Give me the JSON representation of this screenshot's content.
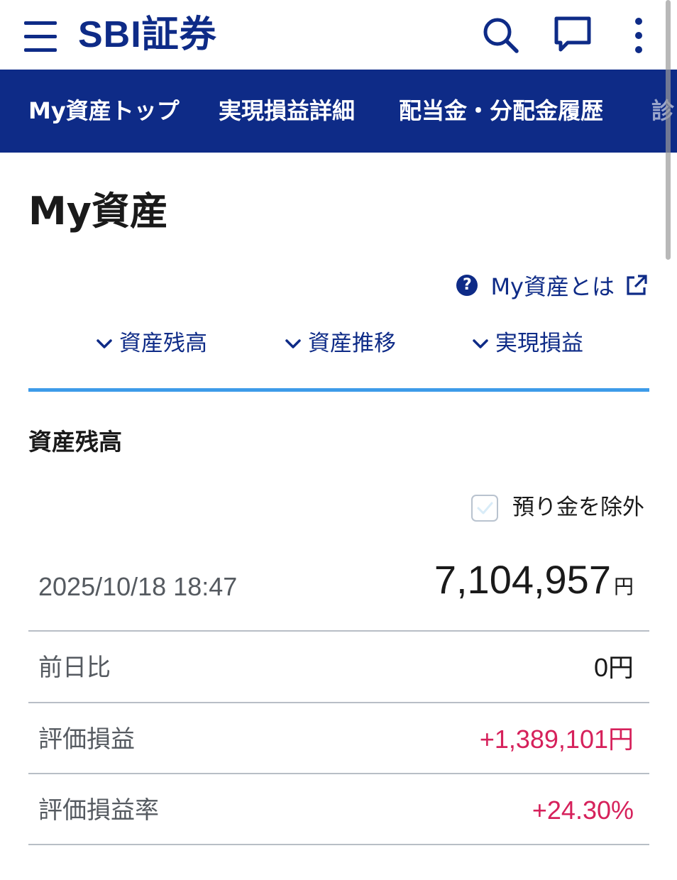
{
  "header": {
    "logo_text": "SBI証券",
    "icons": [
      "menu-icon",
      "search-icon",
      "chat-icon",
      "kebab-menu-icon"
    ]
  },
  "nav": {
    "items": [
      {
        "label": "My資産トップ"
      },
      {
        "label": "実現損益詳細"
      },
      {
        "label": "配当金・分配金履歴"
      },
      {
        "label": "診"
      }
    ]
  },
  "page": {
    "title": "My資産",
    "help_link": "My資産とは",
    "help_icon_glyph": "?"
  },
  "anchors": [
    {
      "label": "資産残高"
    },
    {
      "label": "資産推移"
    },
    {
      "label": "実現損益"
    }
  ],
  "balance": {
    "heading": "資産残高",
    "exclude_deposit_label": "預り金を除外",
    "timestamp": "2025/10/18 18:47",
    "total_amount": "7,104,957",
    "total_unit": "円",
    "rows": [
      {
        "label": "前日比",
        "value": "0円"
      },
      {
        "label": "評価損益",
        "value": "+1,389,101円"
      },
      {
        "label": "評価損益率",
        "value": "+24.30%"
      }
    ]
  },
  "colors": {
    "brand_navy": "#0e2b87",
    "accent_blue": "#3d9be9",
    "positive_red": "#d6215b"
  }
}
